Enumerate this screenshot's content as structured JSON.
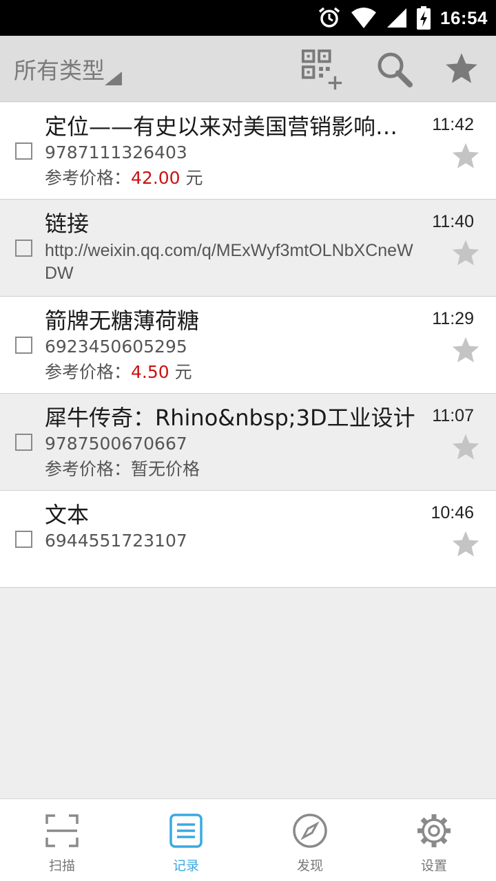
{
  "status_bar": {
    "time": "16:54",
    "icons": [
      "alarm-icon",
      "wifi-icon",
      "signal-icon",
      "battery-charging-icon"
    ]
  },
  "toolbar": {
    "type_filter": "所有类型",
    "actions": [
      "qr-add-icon",
      "search-icon",
      "favorites-star-icon"
    ]
  },
  "records": [
    {
      "title": "定位——有史以来对美国营销影响最大的观念",
      "code": "9787111326403",
      "price_label": "参考价格：",
      "price_value": "42.00",
      "price_unit": "元",
      "time": "11:42",
      "starred": false
    },
    {
      "title": "链接",
      "url": "http://weixin.qq.com/q/MExWyf3mtOLNbXCneWDW",
      "time": "11:40",
      "starred": false
    },
    {
      "title": "箭牌无糖薄荷糖",
      "code": "6923450605295",
      "price_label": "参考价格：",
      "price_value": "4.50",
      "price_unit": "元",
      "time": "11:29",
      "starred": false
    },
    {
      "title": "犀牛传奇：Rhino&nbsp;3D工业设计",
      "code": "9787500670667",
      "price_label": "参考价格：",
      "price_note": "暂无价格",
      "time": "11:07",
      "starred": false
    },
    {
      "title": "文本",
      "code": "6944551723107",
      "time": "10:46",
      "starred": false
    }
  ],
  "bottom_nav": [
    {
      "label": "扫描",
      "icon": "scan-icon",
      "active": false
    },
    {
      "label": "记录",
      "icon": "records-list-icon",
      "active": true
    },
    {
      "label": "发现",
      "icon": "compass-icon",
      "active": false
    },
    {
      "label": "设置",
      "icon": "gear-icon",
      "active": false
    }
  ],
  "colors": {
    "accent": "#39a9e1",
    "price": "#cc1111",
    "toolbar": "#dedede"
  }
}
